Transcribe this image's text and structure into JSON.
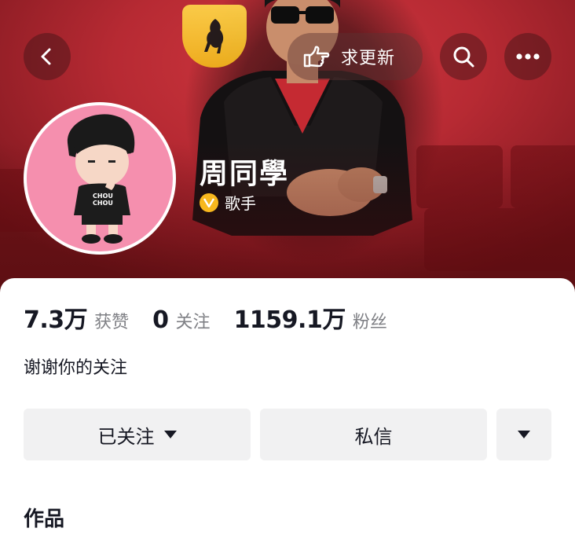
{
  "header": {
    "back_icon": "chevron-left-icon",
    "update_button_label": "求更新",
    "update_icon": "pointing-hand-icon",
    "search_icon": "search-icon",
    "more_icon": "more-dots-icon",
    "banner_color": "#b72a33"
  },
  "profile": {
    "name": "周同學",
    "verified_label": "歌手",
    "verified_badge_color": "#f8b81e",
    "avatar_bg_color": "#f58fae",
    "shirt_text": [
      "CHOU",
      "CHOU"
    ]
  },
  "stats": [
    {
      "value": "7.3万",
      "label": "获赞"
    },
    {
      "value": "0",
      "label": "关注"
    },
    {
      "value": "1159.1万",
      "label": "粉丝"
    }
  ],
  "bio": "谢谢你的关注",
  "actions": {
    "follow_label": "已关注",
    "message_label": "私信"
  },
  "section": {
    "works_title": "作品"
  }
}
